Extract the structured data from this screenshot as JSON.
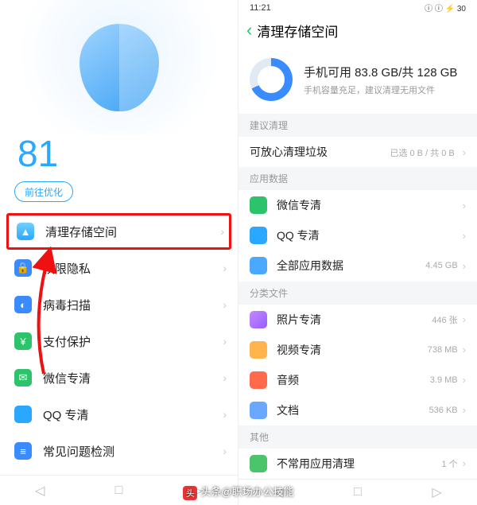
{
  "left": {
    "score": "81",
    "optimize_btn": "前往优化",
    "menu": [
      {
        "label": "清理存储空间",
        "icon": "rocket-icon",
        "highlighted": true
      },
      {
        "label": "权限隐私",
        "icon": "lock-icon"
      },
      {
        "label": "病毒扫描",
        "icon": "virus-icon"
      },
      {
        "label": "支付保护",
        "icon": "pay-icon"
      },
      {
        "label": "微信专清",
        "icon": "wechat-icon"
      },
      {
        "label": "QQ 专清",
        "icon": "qq-icon"
      },
      {
        "label": "常见问题检测",
        "icon": "list-icon"
      }
    ],
    "nav": {
      "back": "◁",
      "home": "□",
      "recent": "▷"
    }
  },
  "right": {
    "status": {
      "time": "11:21",
      "icons": "ⓘ ⓘ ⚡ 30"
    },
    "header_title": "清理存储空间",
    "storage": {
      "title": "手机可用 83.8 GB/共 128 GB",
      "sub": "手机容量充足，建议清理无用文件"
    },
    "sections": {
      "suggest": {
        "hdr": "建议清理",
        "row_label": "可放心清理垃圾",
        "row_meta": "已选 0 B / 共 0 B"
      },
      "appdata": {
        "hdr": "应用数据",
        "items": [
          {
            "label": "微信专清",
            "meta": "",
            "icon": "wechat-icon"
          },
          {
            "label": "QQ 专清",
            "meta": "",
            "icon": "qq-icon"
          },
          {
            "label": "全部应用数据",
            "meta": "4.45 GB",
            "icon": "all-icon"
          }
        ]
      },
      "files": {
        "hdr": "分类文件",
        "items": [
          {
            "label": "照片专清",
            "meta": "446 张",
            "icon": "photo-icon"
          },
          {
            "label": "视频专清",
            "meta": "738 MB",
            "icon": "video-icon"
          },
          {
            "label": "音频",
            "meta": "3.9 MB",
            "icon": "audio-icon"
          },
          {
            "label": "文档",
            "meta": "536 KB",
            "icon": "doc-icon"
          }
        ]
      },
      "other": {
        "hdr": "其他",
        "items": [
          {
            "label": "不常用应用清理",
            "meta": "1 个",
            "icon": "app-icon"
          }
        ]
      }
    }
  },
  "credit": "头条@职场办公技能"
}
